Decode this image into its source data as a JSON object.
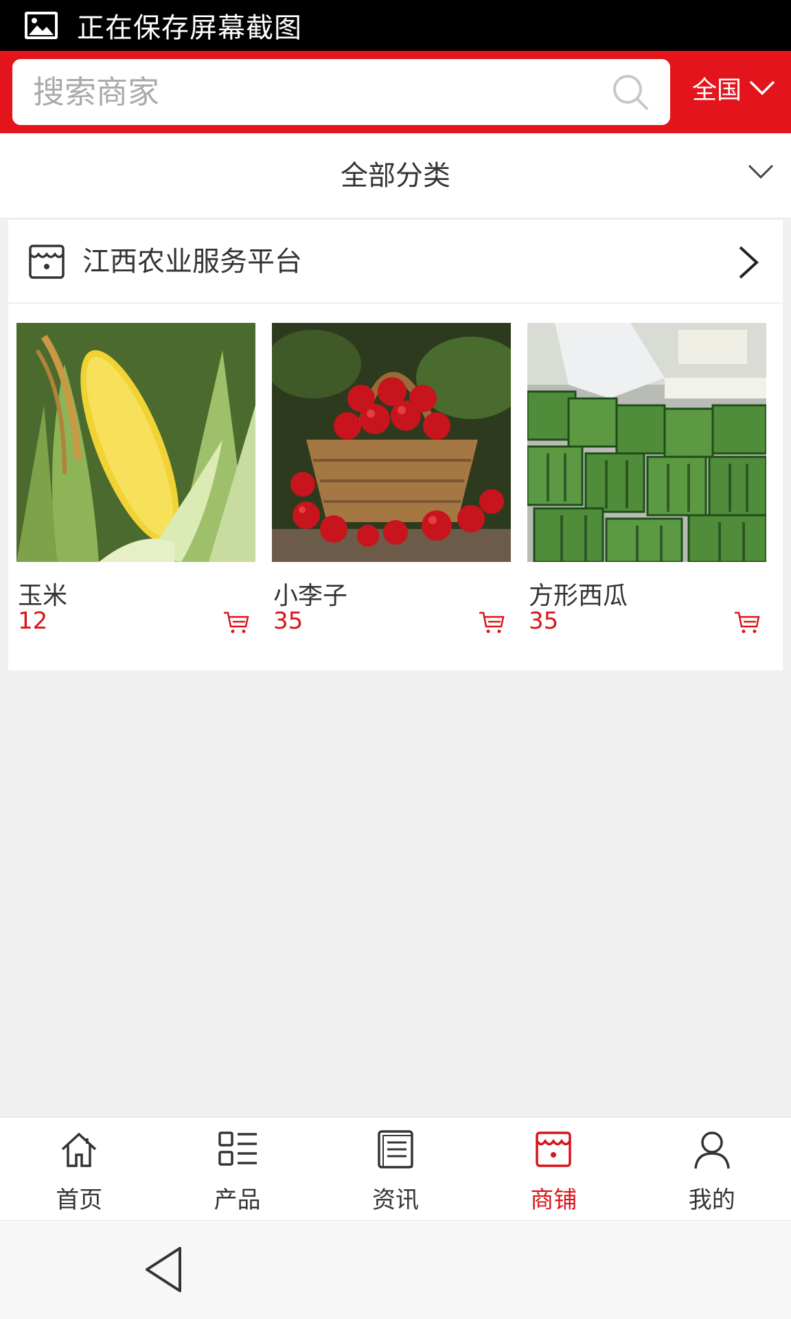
{
  "status_bar": {
    "text": "正在保存屏幕截图",
    "icon": "image-icon"
  },
  "header": {
    "search_placeholder": "搜索商家",
    "region_label": "全国",
    "accent_color": "#e3141c"
  },
  "filter": {
    "category_label": "全部分类"
  },
  "shop": {
    "name": "江西农业服务平台",
    "products": [
      {
        "name": "玉米",
        "price": "12",
        "image": "corn"
      },
      {
        "name": "小李子",
        "price": "35",
        "image": "red-plums-basket"
      },
      {
        "name": "方形西瓜",
        "price": "35",
        "image": "square-watermelons"
      }
    ]
  },
  "bottom_nav": {
    "items": [
      {
        "label": "首页",
        "icon": "home-icon"
      },
      {
        "label": "产品",
        "icon": "grid-list-icon"
      },
      {
        "label": "资讯",
        "icon": "news-icon"
      },
      {
        "label": "商铺",
        "icon": "store-icon",
        "active": true
      },
      {
        "label": "我的",
        "icon": "user-icon"
      }
    ],
    "active_color": "#d8141a"
  }
}
